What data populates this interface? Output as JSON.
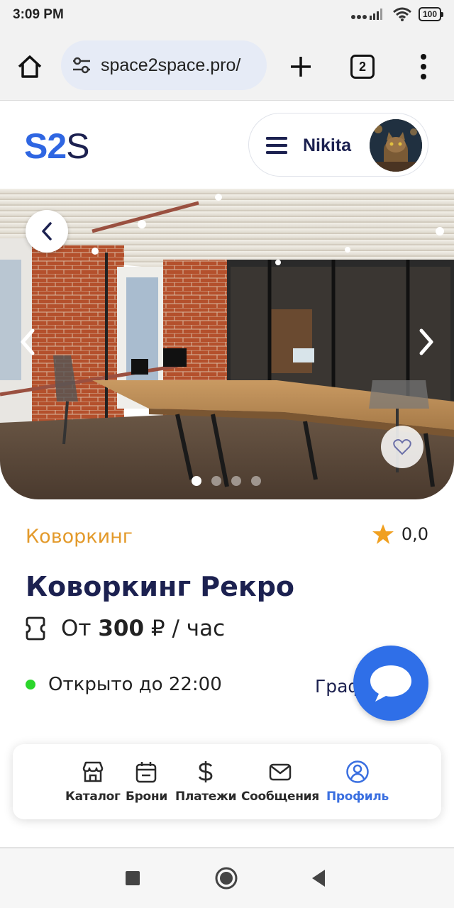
{
  "status_bar": {
    "time": "3:09 PM",
    "battery": "100"
  },
  "browser": {
    "url": "space2space.pro/",
    "tab_count": "2"
  },
  "header": {
    "logo_primary": "S2",
    "logo_secondary": "S",
    "user_name": "Nikita"
  },
  "gallery": {
    "photo_count": 4,
    "active_index": 0
  },
  "listing": {
    "category": "Коворкинг",
    "rating": "0,0",
    "title": "Коворкинг Рекро",
    "price_prefix": "От",
    "price_value": "300",
    "price_suffix": "₽ / час",
    "open_status": "Открыто до 22:00",
    "schedule_link": "Граф"
  },
  "bottom_nav": {
    "items": [
      {
        "label": "Каталог",
        "icon": "store-icon"
      },
      {
        "label": "Брони",
        "icon": "calendar-icon"
      },
      {
        "label": "Платежи",
        "icon": "dollar-icon"
      },
      {
        "label": "Сообщения",
        "icon": "mail-icon"
      },
      {
        "label": "Профиль",
        "icon": "profile-icon"
      }
    ],
    "active": "Профиль"
  },
  "colors": {
    "brand_blue": "#2f66e2",
    "navy": "#1c2150",
    "accent_orange": "#e39a2b",
    "star": "#f0a020",
    "open_green": "#2bd62b",
    "fab_blue": "#2f6fe8"
  }
}
